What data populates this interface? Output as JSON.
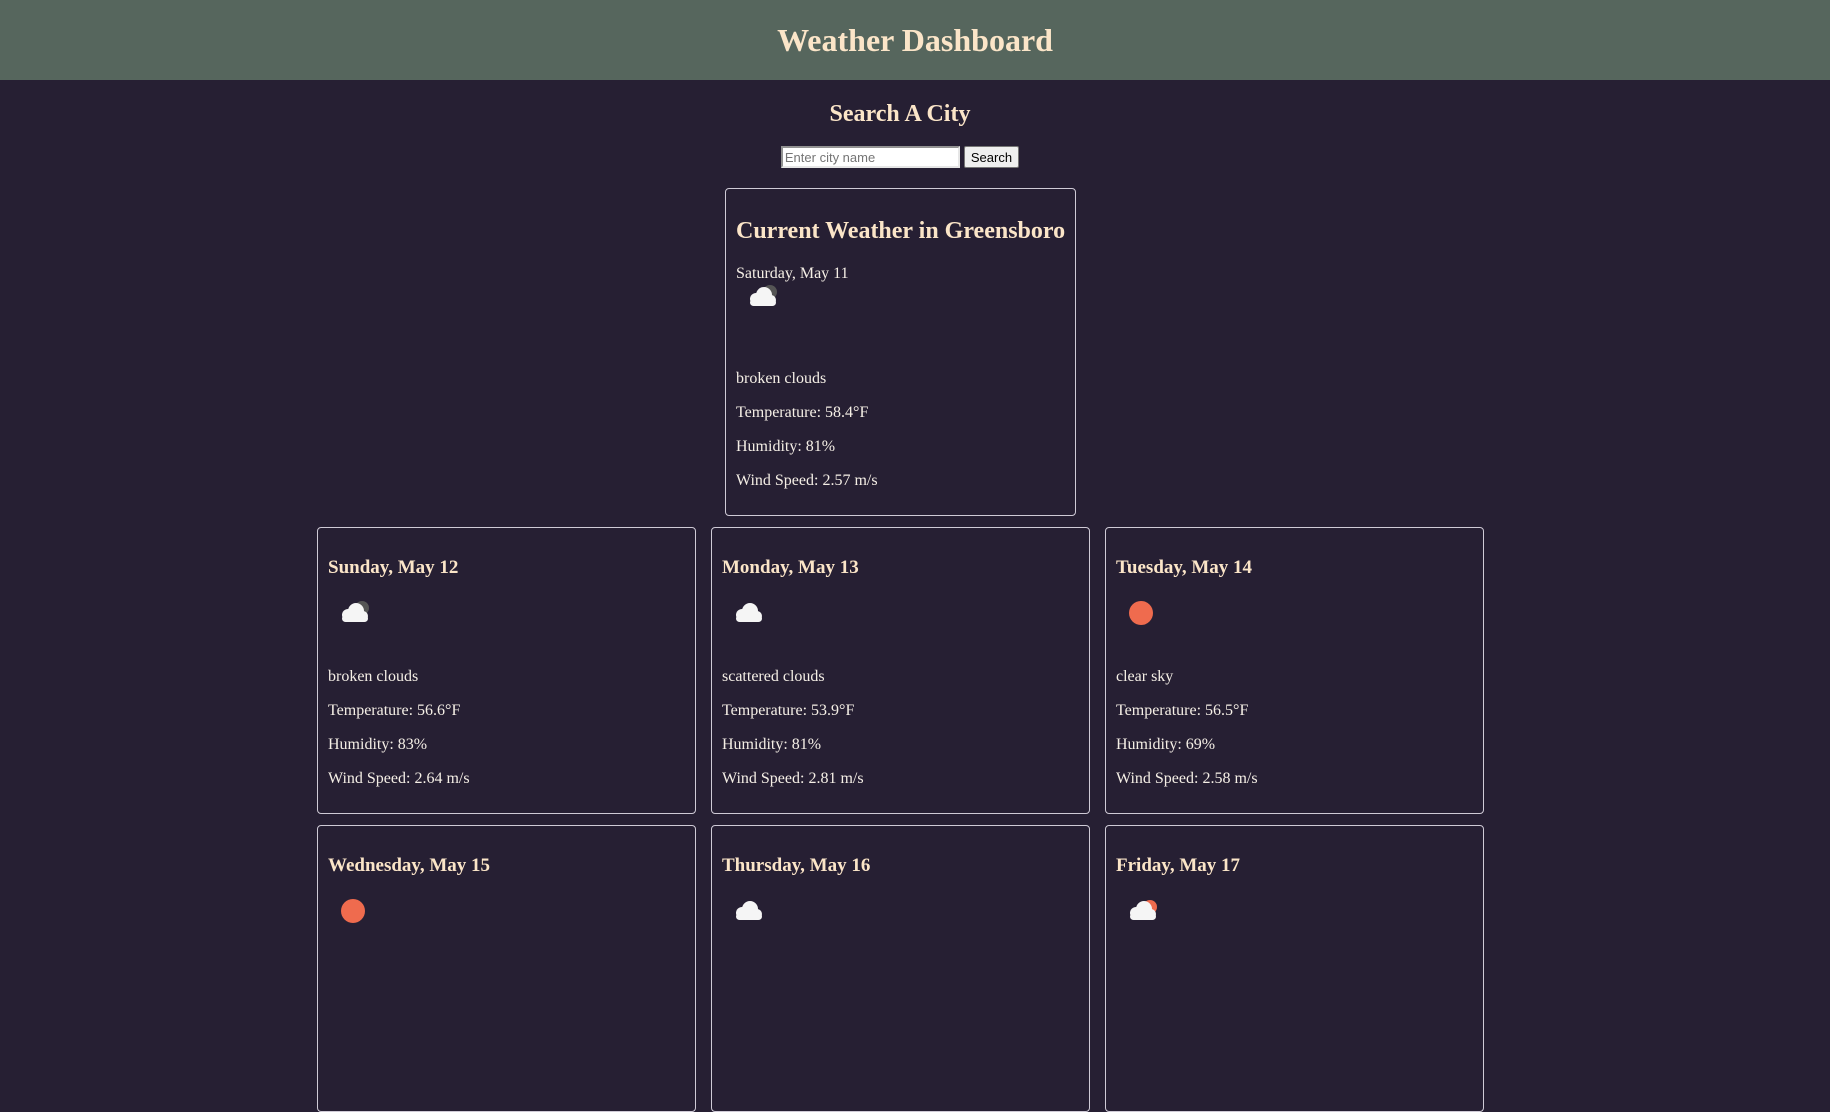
{
  "header": {
    "title": "Weather Dashboard"
  },
  "search": {
    "heading": "Search A City",
    "placeholder": "Enter city name",
    "value": "",
    "button_label": "Search"
  },
  "current": {
    "heading": "Current Weather in Greensboro",
    "date": "Saturday, May 11",
    "icon": "broken-clouds-icon",
    "description": "broken clouds",
    "temperature": "Temperature: 58.4°F",
    "humidity": "Humidity: 81%",
    "wind": "Wind Speed: 2.57 m/s"
  },
  "forecast": [
    {
      "date": "Sunday, May 12",
      "icon": "broken-clouds-icon",
      "description": "broken clouds",
      "temperature": "Temperature: 56.6°F",
      "humidity": "Humidity: 83%",
      "wind": "Wind Speed: 2.64 m/s"
    },
    {
      "date": "Monday, May 13",
      "icon": "scattered-clouds-icon",
      "description": "scattered clouds",
      "temperature": "Temperature: 53.9°F",
      "humidity": "Humidity: 81%",
      "wind": "Wind Speed: 2.81 m/s"
    },
    {
      "date": "Tuesday, May 14",
      "icon": "clear-sky-icon",
      "description": "clear sky",
      "temperature": "Temperature: 56.5°F",
      "humidity": "Humidity: 69%",
      "wind": "Wind Speed: 2.58 m/s"
    },
    {
      "date": "Wednesday, May 15",
      "icon": "clear-sky-icon"
    },
    {
      "date": "Thursday, May 16",
      "icon": "scattered-clouds-icon"
    },
    {
      "date": "Friday, May 17",
      "icon": "few-clouds-icon"
    }
  ],
  "colors": {
    "background": "#261f33",
    "header_bg": "#56665d",
    "title_text": "#fbe5c8",
    "sun": "#ef6b4e",
    "cloud": "#f5f5f5",
    "dark_cloud": "#555555"
  }
}
